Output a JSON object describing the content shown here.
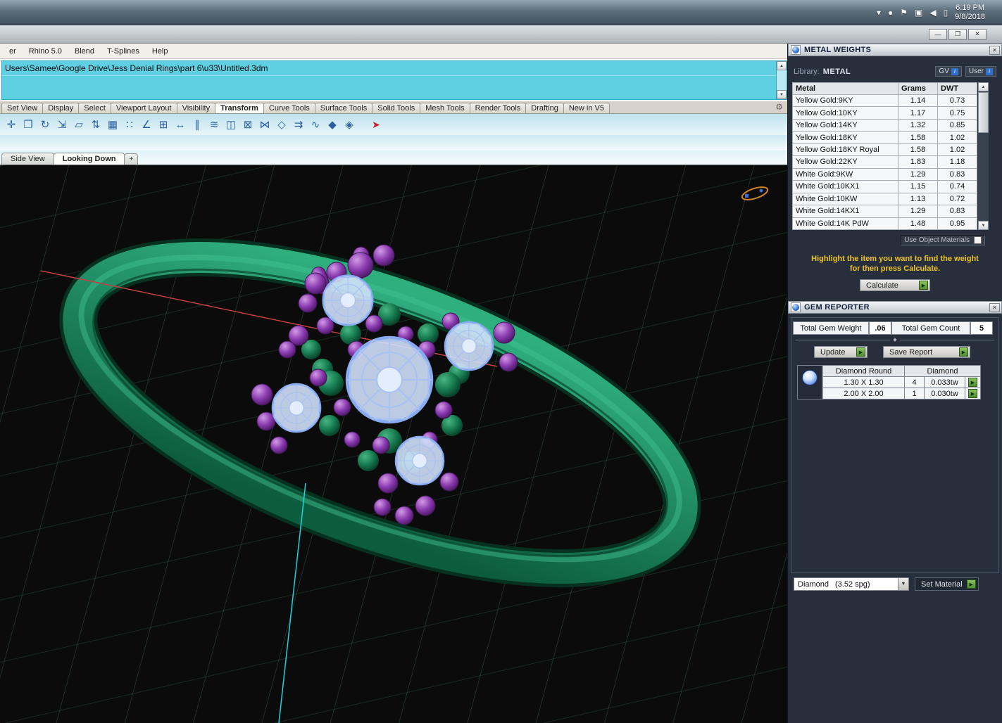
{
  "taskbar": {
    "time": "6:19 PM",
    "date": "9/8/2018",
    "tray_icons": [
      {
        "name": "hidden-icons-icon",
        "glyph": "▾"
      },
      {
        "name": "updates-icon",
        "glyph": "●"
      },
      {
        "name": "flag-icon",
        "glyph": "⚑"
      },
      {
        "name": "network-icon",
        "glyph": "▣"
      },
      {
        "name": "volume-icon",
        "glyph": "◀"
      },
      {
        "name": "power-icon",
        "glyph": "▯"
      }
    ]
  },
  "titlebar": {
    "minimize": "—",
    "restore": "❐",
    "close": "✕"
  },
  "menubar": {
    "items": [
      "er",
      "Rhino 5.0",
      "Blend",
      "T-Splines",
      "Help"
    ]
  },
  "command": {
    "path": "Users\\Samee\\Google Drive\\Jess Denial Rings\\part 6\\u33\\Untitled.3dm"
  },
  "tabs": {
    "before": [
      "Set View",
      "Display",
      "Select",
      "Viewport Layout",
      "Visibility"
    ],
    "active": "Transform",
    "after": [
      "Curve Tools",
      "Surface Tools",
      "Solid Tools",
      "Mesh Tools",
      "Render Tools",
      "Drafting",
      "New in V5"
    ]
  },
  "toolbar": {
    "icons": [
      {
        "name": "move-icon",
        "glyph": "✛"
      },
      {
        "name": "copy-icon",
        "glyph": "❐"
      },
      {
        "name": "rotate-icon",
        "glyph": "↻"
      },
      {
        "name": "scale-icon",
        "glyph": "⇲"
      },
      {
        "name": "shear-icon",
        "glyph": "▱"
      },
      {
        "name": "flip-icon",
        "glyph": "⇅"
      },
      {
        "name": "array-icon",
        "glyph": "▦"
      },
      {
        "name": "array-polar-icon",
        "glyph": "∷"
      },
      {
        "name": "rotate-3d-icon",
        "glyph": "∠"
      },
      {
        "name": "array-rect-icon",
        "glyph": "⊞"
      },
      {
        "name": "mirror-icon",
        "glyph": "↔"
      },
      {
        "name": "offset-icon",
        "glyph": "∥"
      },
      {
        "name": "smooth-icon",
        "glyph": "≋"
      },
      {
        "name": "orient-icon",
        "glyph": "◫"
      },
      {
        "name": "project-icon",
        "glyph": "⊠"
      },
      {
        "name": "morph-icon",
        "glyph": "⋈"
      },
      {
        "name": "cage-edit-icon",
        "glyph": "◇"
      },
      {
        "name": "flow-icon",
        "glyph": "⇉"
      },
      {
        "name": "bend-icon",
        "glyph": "∿"
      },
      {
        "name": "taper-icon",
        "glyph": "◆"
      },
      {
        "name": "twist-icon",
        "glyph": "◈"
      },
      {
        "name": "last-tool-icon",
        "glyph": "➤"
      }
    ]
  },
  "viewport": {
    "inactive_tab": "Side View",
    "active_tab": "Looking Down",
    "add_tab": "+"
  },
  "metal_weights": {
    "title": "METAL WEIGHTS",
    "library_label": "Library:",
    "library_value": "METAL",
    "gv_button": "GV",
    "user_button": "User",
    "columns": [
      "Metal",
      "Grams",
      "DWT"
    ],
    "rows": [
      [
        "Yellow Gold:9KY",
        "1.14",
        "0.73"
      ],
      [
        "Yellow Gold:10KY",
        "1.17",
        "0.75"
      ],
      [
        "Yellow Gold:14KY",
        "1.32",
        "0.85"
      ],
      [
        "Yellow Gold:18KY",
        "1.58",
        "1.02"
      ],
      [
        "Yellow Gold:18KY Royal",
        "1.58",
        "1.02"
      ],
      [
        "Yellow Gold:22KY",
        "1.83",
        "1.18"
      ],
      [
        "White Gold:9KW",
        "1.29",
        "0.83"
      ],
      [
        "White Gold:10KX1",
        "1.15",
        "0.74"
      ],
      [
        "White Gold:10KW",
        "1.13",
        "0.72"
      ],
      [
        "White Gold:14KX1",
        "1.29",
        "0.83"
      ],
      [
        "White Gold:14K PdW",
        "1.48",
        "0.95"
      ]
    ],
    "use_object_materials": "Use Object Materials",
    "instruction_line1": "Highlight the item you want to find the weight",
    "instruction_line2": "for then press Calculate.",
    "calculate_label": "Calculate"
  },
  "gem_reporter": {
    "title": "GEM REPORTER",
    "total_weight_label": "Total Gem Weight",
    "total_weight_value": ".06",
    "total_count_label": "Total Gem Count",
    "total_count_value": "5",
    "update_label": "Update",
    "save_report_label": "Save Report",
    "table_header": [
      "Diamond Round",
      "Diamond"
    ],
    "gem_rows": [
      [
        "1.30 X 1.30",
        "4",
        "0.033tw"
      ],
      [
        "2.00 X 2.00",
        "1",
        "0.030tw"
      ]
    ],
    "material_name": "Diamond",
    "material_spg": "(3.52 spg)",
    "set_material_label": "Set Material"
  },
  "icons": {
    "close": "✕",
    "info": "i",
    "up_arrow": "▲",
    "down_arrow": "▼",
    "play": "▶",
    "dropdown_arrow": "▼",
    "gear": "⚙",
    "splitter_handle": "◆"
  }
}
